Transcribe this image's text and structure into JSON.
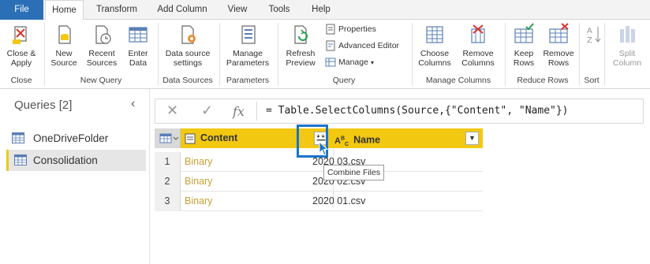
{
  "tabs": [
    "File",
    "Home",
    "Transform",
    "Add Column",
    "View",
    "Tools",
    "Help"
  ],
  "ribbon": {
    "close_apply": "Close &\nApply",
    "new_source": "New\nSource",
    "recent_sources": "Recent\nSources",
    "enter_data": "Enter\nData",
    "data_source_settings": "Data source\nsettings",
    "manage_parameters": "Manage\nParameters",
    "refresh_preview": "Refresh\nPreview",
    "properties": "Properties",
    "advanced_editor": "Advanced Editor",
    "manage": "Manage",
    "choose_columns": "Choose\nColumns",
    "remove_columns": "Remove\nColumns",
    "keep_rows": "Keep\nRows",
    "remove_rows": "Remove\nRows",
    "split_column": "Split\nColumn",
    "groups": {
      "close": "Close",
      "new_query": "New Query",
      "data_sources": "Data Sources",
      "parameters": "Parameters",
      "query": "Query",
      "manage_columns": "Manage Columns",
      "reduce_rows": "Reduce Rows",
      "sort": "Sort"
    }
  },
  "queries": {
    "title": "Queries [2]",
    "items": [
      "OneDriveFolder",
      "Consolidation"
    ]
  },
  "formula": "= Table.SelectColumns(Source,{\"Content\", \"Name\"})",
  "grid": {
    "columns": [
      "Content",
      "Name"
    ],
    "rows": [
      {
        "n": "1",
        "content": "Binary",
        "name": "2020 03.csv"
      },
      {
        "n": "2",
        "content": "Binary",
        "name": "2020 02.csv"
      },
      {
        "n": "3",
        "content": "Binary",
        "name": "2020 01.csv"
      }
    ]
  },
  "tooltip": "Combine Files",
  "colors": {
    "file_tab": "#2b6fb6",
    "header": "#f2c811",
    "binary": "#c5a13a",
    "highlight": "#1a73c9"
  }
}
